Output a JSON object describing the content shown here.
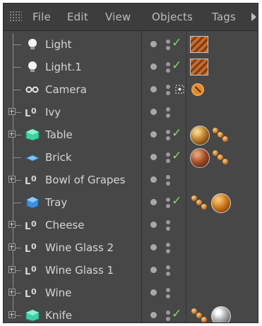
{
  "menu": {
    "items": [
      {
        "label": "File"
      },
      {
        "label": "Edit"
      },
      {
        "label": "View"
      },
      {
        "label": "Objects"
      },
      {
        "label": "Tags"
      }
    ]
  },
  "objects": [
    {
      "name": "Light",
      "icon": "light-bulb-icon",
      "expandable": false,
      "tags": [
        "checkmark",
        "texture-wood"
      ]
    },
    {
      "name": "Light.1",
      "icon": "light-bulb-icon",
      "expandable": false,
      "tags": [
        "checkmark",
        "texture-wood"
      ]
    },
    {
      "name": "Camera",
      "icon": "camera-icon",
      "expandable": false,
      "tags": [
        "compositing-tag",
        "protection-tag"
      ]
    },
    {
      "name": "Ivy",
      "icon": "null-object-icon",
      "expandable": true,
      "tags": []
    },
    {
      "name": "Table",
      "icon": "polygon-object-icon",
      "expandable": true,
      "tags": [
        "checkmark",
        "material-gold",
        "material-dots"
      ]
    },
    {
      "name": "Brick",
      "icon": "plane-object-icon",
      "expandable": false,
      "tags": [
        "checkmark",
        "material-brick",
        "material-dots"
      ]
    },
    {
      "name": "Bowl of Grapes",
      "icon": "null-object-icon",
      "expandable": true,
      "tags": []
    },
    {
      "name": "Tray",
      "icon": "cube-object-icon",
      "expandable": false,
      "tags": [
        "checkmark",
        "material-dots",
        "material-wood"
      ]
    },
    {
      "name": "Cheese",
      "icon": "null-object-icon",
      "expandable": true,
      "tags": []
    },
    {
      "name": "Wine Glass 2",
      "icon": "null-object-icon",
      "expandable": true,
      "tags": []
    },
    {
      "name": "Wine Glass 1",
      "icon": "null-object-icon",
      "expandable": true,
      "tags": []
    },
    {
      "name": "Wine",
      "icon": "null-object-icon",
      "expandable": true,
      "tags": []
    },
    {
      "name": "Knife",
      "icon": "polygon-object-icon",
      "expandable": true,
      "tags": [
        "checkmark",
        "material-dots",
        "material-silver"
      ]
    }
  ]
}
